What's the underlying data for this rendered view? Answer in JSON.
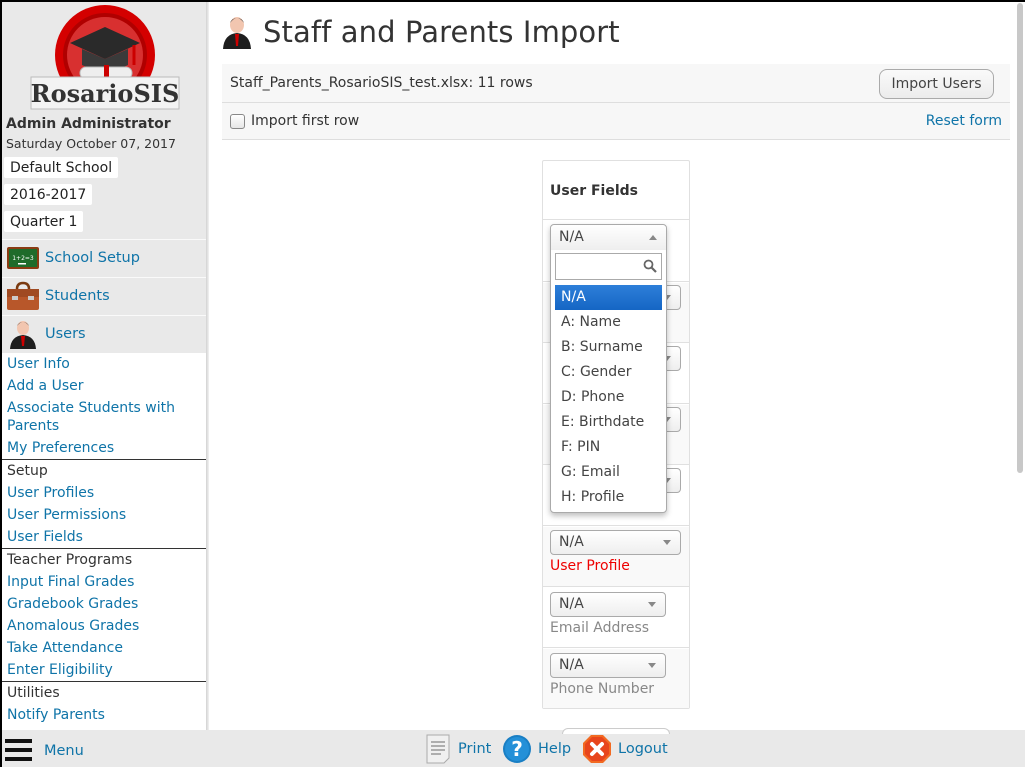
{
  "sidebar": {
    "logo_text": "RosarioSIS",
    "user_name": "Admin Administrator",
    "date": "Saturday October 07, 2017",
    "school": "Default School",
    "school_year": "2016-2017",
    "marking_period": "Quarter 1",
    "categories": [
      {
        "label": "School Setup",
        "icon": "chalkboard-icon"
      },
      {
        "label": "Students",
        "icon": "briefcase-icon"
      },
      {
        "label": "Users",
        "icon": "user-icon"
      }
    ],
    "submenu": {
      "items_top": [
        "User Info",
        "Add a User",
        "Associate Students with Parents",
        "My Preferences"
      ],
      "setup_header": "Setup",
      "setup_items": [
        "User Profiles",
        "User Permissions",
        "User Fields"
      ],
      "teacher_header": "Teacher Programs",
      "teacher_items": [
        "Input Final Grades",
        "Gradebook Grades",
        "Anomalous Grades",
        "Take Attendance",
        "Enter Eligibility"
      ],
      "utilities_header": "Utilities",
      "utilities_items": [
        "Notify Parents"
      ]
    }
  },
  "main": {
    "title": "Staff and Parents Import",
    "file_info": "Staff_Parents_RosarioSIS_test.xlsx: 11 rows",
    "import_button": "Import Users",
    "import_first_row_label": "Import first row",
    "import_first_row_checked": false,
    "reset_form": "Reset form",
    "fields_table": {
      "header": "User Fields",
      "rows": [
        {
          "value": "N/A",
          "label": "",
          "required": false
        },
        {
          "value": "N/A",
          "label": "",
          "required": false
        },
        {
          "value": "N/A",
          "label": "",
          "required": false
        },
        {
          "value": "N/A",
          "label": "",
          "required": false
        },
        {
          "value": "N/A",
          "label": "",
          "required": false
        },
        {
          "value": "N/A",
          "label": "User Profile",
          "required": true
        },
        {
          "value": "N/A",
          "label": "Email Address",
          "required": false
        },
        {
          "value": "N/A",
          "label": "Phone Number",
          "required": false
        }
      ]
    },
    "open_dropdown": {
      "current": "N/A",
      "search_placeholder": "",
      "selected_index": 0,
      "options": [
        "N/A",
        "A: Name",
        "B: Surname",
        "C: Gender",
        "D: Phone",
        "E: Birthdate",
        "F: PIN",
        "G: Email",
        "H: Profile"
      ]
    }
  },
  "bottom_bar": {
    "menu": "Menu",
    "print": "Print",
    "help": "Help",
    "logout": "Logout"
  },
  "colors": {
    "link": "#0f74a8",
    "selected_option": "#1a6fd0",
    "required_label": "#e00000",
    "sidebar_bg": "#e9e9e9"
  }
}
